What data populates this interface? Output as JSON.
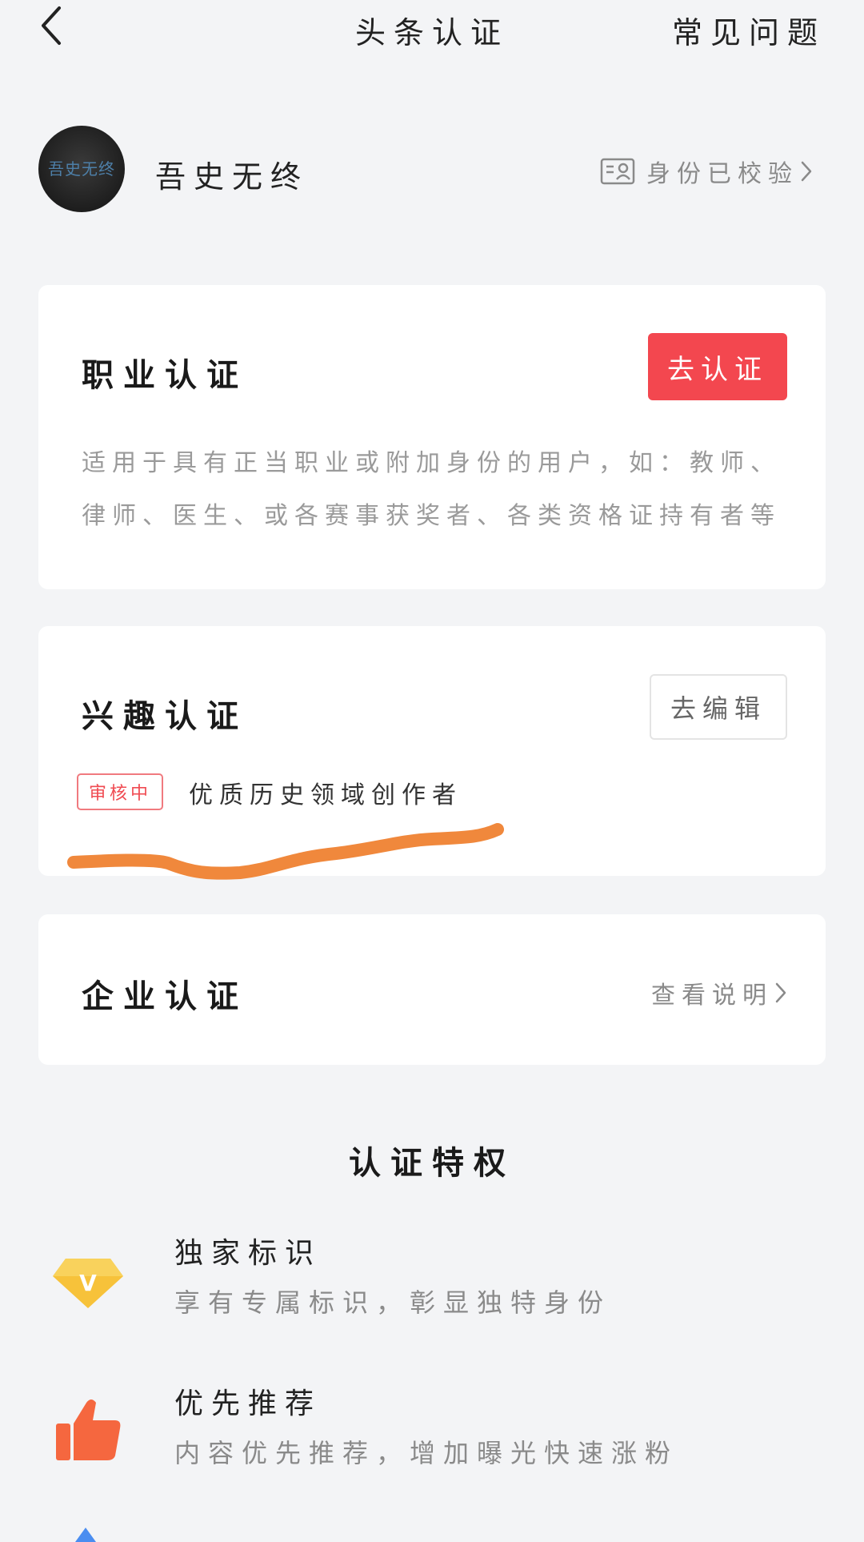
{
  "header": {
    "title": "头条认证",
    "faq_label": "常见问题"
  },
  "profile": {
    "avatar_text": "吾史无终",
    "username": "吾史无终",
    "verified_label": "身份已校验"
  },
  "cards": {
    "career": {
      "title": "职业认证",
      "button_label": "去认证",
      "description": "适用于具有正当职业或附加身份的用户，如：教师、律师、医生、或各赛事获奖者、各类资格证持有者等"
    },
    "interest": {
      "title": "兴趣认证",
      "button_label": "去编辑",
      "status_badge": "审核中",
      "status_text": "优质历史领域创作者"
    },
    "enterprise": {
      "title": "企业认证",
      "link_label": "查看说明"
    }
  },
  "privileges": {
    "title": "认证特权",
    "items": [
      {
        "icon": "diamond-v-icon",
        "title": "独家标识",
        "desc": "享有专属标识，彰显独特身份"
      },
      {
        "icon": "thumbs-up-icon",
        "title": "优先推荐",
        "desc": "内容优先推荐，增加曝光快速涨粉"
      }
    ]
  },
  "colors": {
    "accent_red": "#f3474f",
    "badge_red": "#f04b52",
    "scribble_orange": "#f0883c",
    "diamond_gold": "#f7c23a",
    "thumb_orange": "#f5673f"
  }
}
